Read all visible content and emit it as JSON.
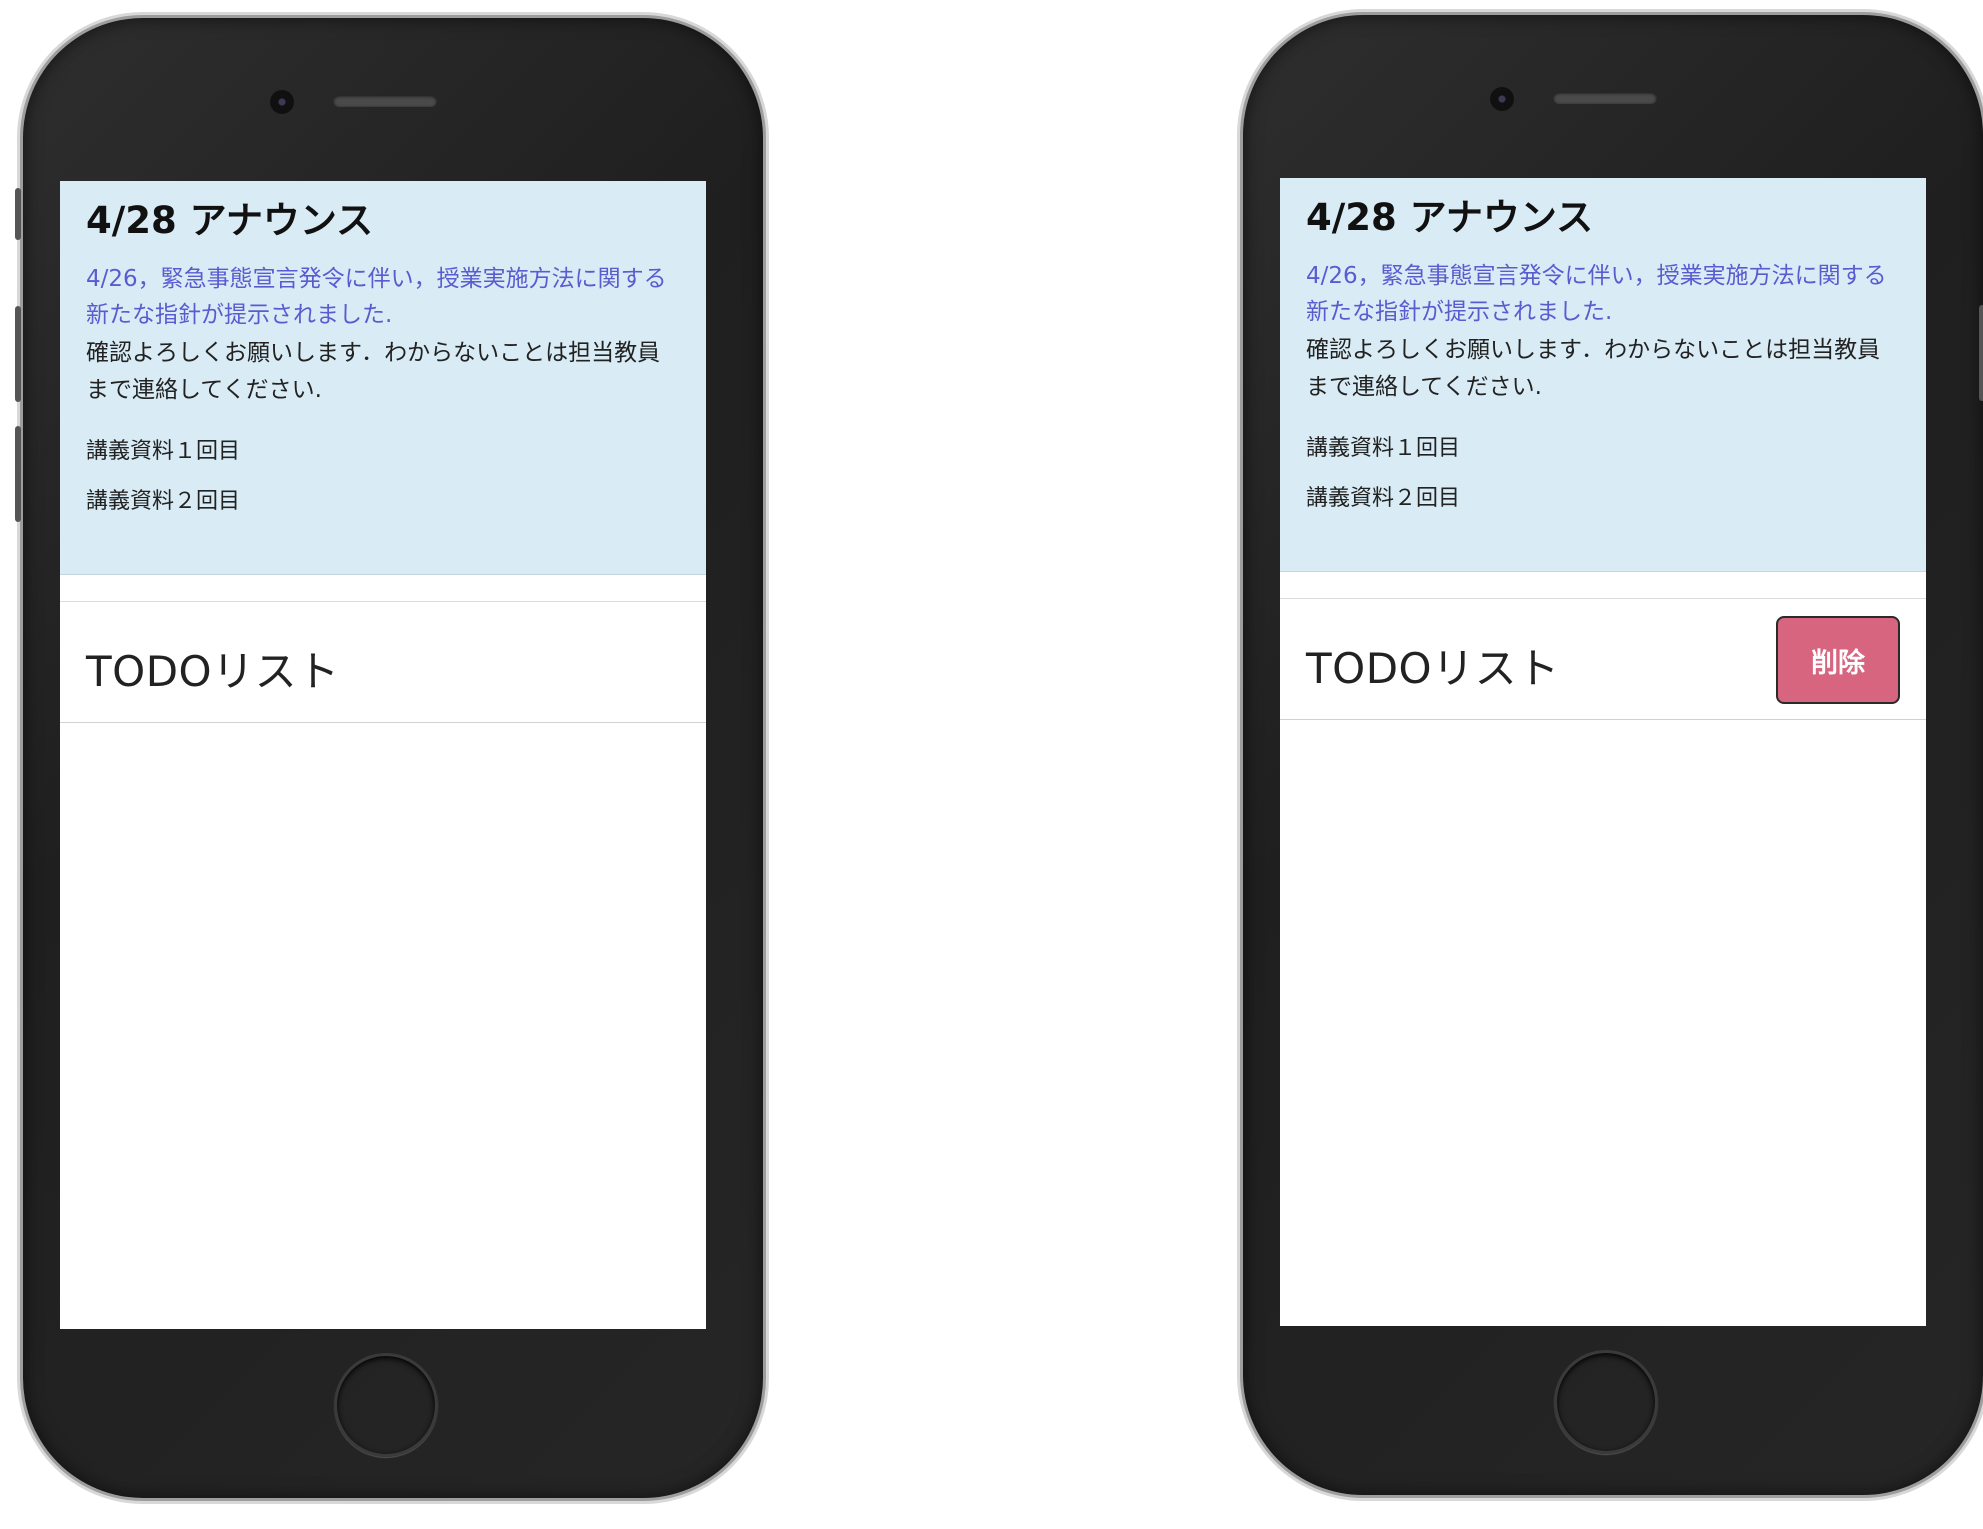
{
  "screens": [
    {
      "id": "left",
      "announcement": {
        "title": "4/28 アナウンス",
        "link_text": "4/26，緊急事態宣言発令に伴い，授業実施方法に関する新たな指針が提示されました.",
        "body": "確認よろしくお願いします．わからないことは担当教員まで連絡してください.",
        "materials": [
          "講義資料１回目",
          "講義資料２回目"
        ]
      },
      "todo": {
        "title": "TODOリスト"
      }
    },
    {
      "id": "right",
      "announcement": {
        "title": "4/28 アナウンス",
        "link_text": "4/26，緊急事態宣言発令に伴い，授業実施方法に関する新たな指針が提示されました.",
        "body": "確認よろしくお願いします．わからないことは担当教員まで連絡してください.",
        "materials": [
          "講義資料１回目",
          "講義資料２回目"
        ]
      },
      "todo": {
        "title": "TODOリスト",
        "delete_label": "削除"
      }
    }
  ],
  "colors": {
    "announcement_bg": "#d9ecf5",
    "link": "#5b5bd0",
    "delete_button": "#d7657f",
    "phone_body": "#262626"
  }
}
